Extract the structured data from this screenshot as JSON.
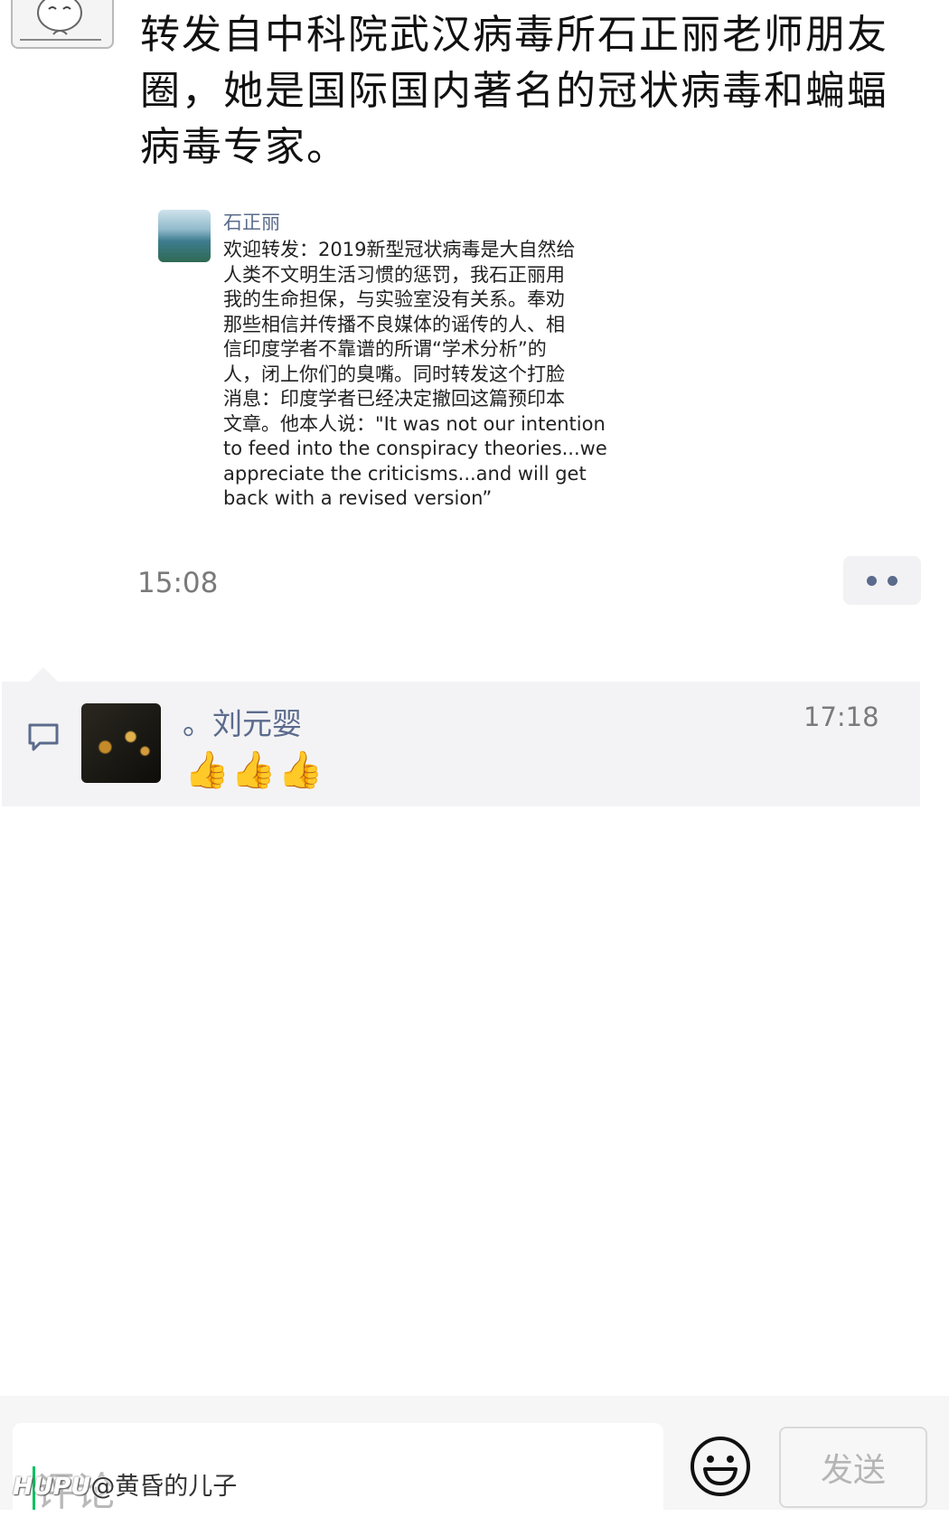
{
  "post": {
    "text": "转发自中科院武汉病毒所石正丽老师朋友圈，她是国际国内著名的冠状病毒和蝙蝠病毒专家。",
    "time": "15:08",
    "shared": {
      "author": "石正丽",
      "body": "欢迎转发：2019新型冠状病毒是大自然给\n人类不文明生活习惯的惩罚，我石正丽用\n我的生命担保，与实验室没有关系。奉劝\n那些相信并传播不良媒体的谣传的人、相\n信印度学者不靠谱的所谓“学术分析”的\n人，闭上你们的臭嘴。同时转发这个打脸\n消息：印度学者已经决定撤回这篇预印本\n文章。他本人说：\"It was not our intention\n to feed into the conspiracy theories...we\nappreciate the criticisms...and will get\nback with a revised version”"
    }
  },
  "comment": {
    "name": "。刘元婴",
    "time": "17:18",
    "emoji": "👍👍👍"
  },
  "bottom_bar": {
    "placeholder": "评论",
    "send_label": "发送"
  },
  "watermark": {
    "brand": "HUPU",
    "user": "@黄昏的儿子"
  },
  "colors": {
    "link": "#5b6b8c",
    "accent": "#07c160",
    "comment_bg": "#f3f3f5"
  }
}
